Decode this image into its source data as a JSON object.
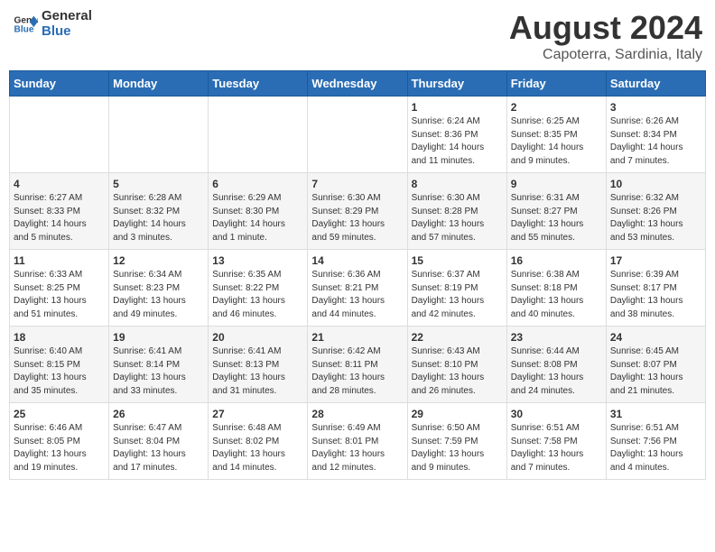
{
  "logo": {
    "line1": "General",
    "line2": "Blue"
  },
  "title": "August 2024",
  "location": "Capoterra, Sardinia, Italy",
  "weekdays": [
    "Sunday",
    "Monday",
    "Tuesday",
    "Wednesday",
    "Thursday",
    "Friday",
    "Saturday"
  ],
  "weeks": [
    [
      {
        "day": "",
        "info": ""
      },
      {
        "day": "",
        "info": ""
      },
      {
        "day": "",
        "info": ""
      },
      {
        "day": "",
        "info": ""
      },
      {
        "day": "1",
        "info": "Sunrise: 6:24 AM\nSunset: 8:36 PM\nDaylight: 14 hours\nand 11 minutes."
      },
      {
        "day": "2",
        "info": "Sunrise: 6:25 AM\nSunset: 8:35 PM\nDaylight: 14 hours\nand 9 minutes."
      },
      {
        "day": "3",
        "info": "Sunrise: 6:26 AM\nSunset: 8:34 PM\nDaylight: 14 hours\nand 7 minutes."
      }
    ],
    [
      {
        "day": "4",
        "info": "Sunrise: 6:27 AM\nSunset: 8:33 PM\nDaylight: 14 hours\nand 5 minutes."
      },
      {
        "day": "5",
        "info": "Sunrise: 6:28 AM\nSunset: 8:32 PM\nDaylight: 14 hours\nand 3 minutes."
      },
      {
        "day": "6",
        "info": "Sunrise: 6:29 AM\nSunset: 8:30 PM\nDaylight: 14 hours\nand 1 minute."
      },
      {
        "day": "7",
        "info": "Sunrise: 6:30 AM\nSunset: 8:29 PM\nDaylight: 13 hours\nand 59 minutes."
      },
      {
        "day": "8",
        "info": "Sunrise: 6:30 AM\nSunset: 8:28 PM\nDaylight: 13 hours\nand 57 minutes."
      },
      {
        "day": "9",
        "info": "Sunrise: 6:31 AM\nSunset: 8:27 PM\nDaylight: 13 hours\nand 55 minutes."
      },
      {
        "day": "10",
        "info": "Sunrise: 6:32 AM\nSunset: 8:26 PM\nDaylight: 13 hours\nand 53 minutes."
      }
    ],
    [
      {
        "day": "11",
        "info": "Sunrise: 6:33 AM\nSunset: 8:25 PM\nDaylight: 13 hours\nand 51 minutes."
      },
      {
        "day": "12",
        "info": "Sunrise: 6:34 AM\nSunset: 8:23 PM\nDaylight: 13 hours\nand 49 minutes."
      },
      {
        "day": "13",
        "info": "Sunrise: 6:35 AM\nSunset: 8:22 PM\nDaylight: 13 hours\nand 46 minutes."
      },
      {
        "day": "14",
        "info": "Sunrise: 6:36 AM\nSunset: 8:21 PM\nDaylight: 13 hours\nand 44 minutes."
      },
      {
        "day": "15",
        "info": "Sunrise: 6:37 AM\nSunset: 8:19 PM\nDaylight: 13 hours\nand 42 minutes."
      },
      {
        "day": "16",
        "info": "Sunrise: 6:38 AM\nSunset: 8:18 PM\nDaylight: 13 hours\nand 40 minutes."
      },
      {
        "day": "17",
        "info": "Sunrise: 6:39 AM\nSunset: 8:17 PM\nDaylight: 13 hours\nand 38 minutes."
      }
    ],
    [
      {
        "day": "18",
        "info": "Sunrise: 6:40 AM\nSunset: 8:15 PM\nDaylight: 13 hours\nand 35 minutes."
      },
      {
        "day": "19",
        "info": "Sunrise: 6:41 AM\nSunset: 8:14 PM\nDaylight: 13 hours\nand 33 minutes."
      },
      {
        "day": "20",
        "info": "Sunrise: 6:41 AM\nSunset: 8:13 PM\nDaylight: 13 hours\nand 31 minutes."
      },
      {
        "day": "21",
        "info": "Sunrise: 6:42 AM\nSunset: 8:11 PM\nDaylight: 13 hours\nand 28 minutes."
      },
      {
        "day": "22",
        "info": "Sunrise: 6:43 AM\nSunset: 8:10 PM\nDaylight: 13 hours\nand 26 minutes."
      },
      {
        "day": "23",
        "info": "Sunrise: 6:44 AM\nSunset: 8:08 PM\nDaylight: 13 hours\nand 24 minutes."
      },
      {
        "day": "24",
        "info": "Sunrise: 6:45 AM\nSunset: 8:07 PM\nDaylight: 13 hours\nand 21 minutes."
      }
    ],
    [
      {
        "day": "25",
        "info": "Sunrise: 6:46 AM\nSunset: 8:05 PM\nDaylight: 13 hours\nand 19 minutes."
      },
      {
        "day": "26",
        "info": "Sunrise: 6:47 AM\nSunset: 8:04 PM\nDaylight: 13 hours\nand 17 minutes."
      },
      {
        "day": "27",
        "info": "Sunrise: 6:48 AM\nSunset: 8:02 PM\nDaylight: 13 hours\nand 14 minutes."
      },
      {
        "day": "28",
        "info": "Sunrise: 6:49 AM\nSunset: 8:01 PM\nDaylight: 13 hours\nand 12 minutes."
      },
      {
        "day": "29",
        "info": "Sunrise: 6:50 AM\nSunset: 7:59 PM\nDaylight: 13 hours\nand 9 minutes."
      },
      {
        "day": "30",
        "info": "Sunrise: 6:51 AM\nSunset: 7:58 PM\nDaylight: 13 hours\nand 7 minutes."
      },
      {
        "day": "31",
        "info": "Sunrise: 6:51 AM\nSunset: 7:56 PM\nDaylight: 13 hours\nand 4 minutes."
      }
    ]
  ]
}
